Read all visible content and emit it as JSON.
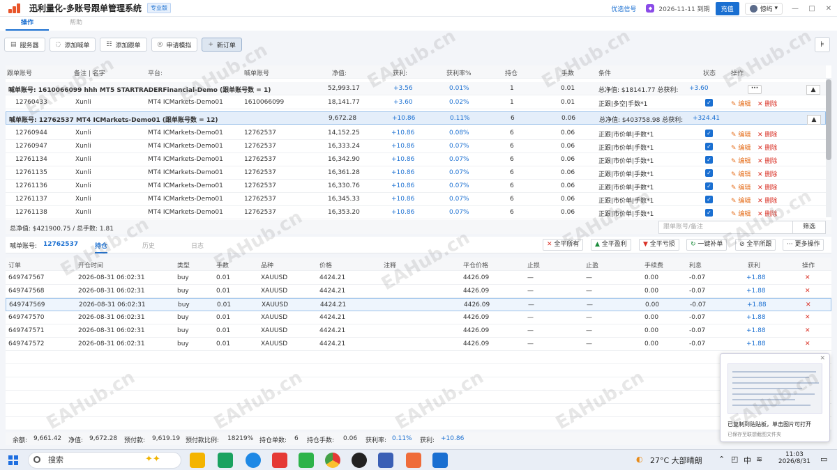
{
  "header": {
    "app_title": "迅利量化-多账号跟单管理系统",
    "edition_badge": "专业版",
    "signal_link": "优选信号",
    "expiry": "2026-11-11 到期",
    "recharge": "充值",
    "username": "惊屿",
    "user_caret": "▾"
  },
  "tabs": [
    "操作",
    "帮助"
  ],
  "toolbar": [
    "服务器",
    "添加喊单",
    "添加跟单",
    "申请模拟",
    "新订单"
  ],
  "follow_table": {
    "headers": [
      "跟单账号",
      "备注 | 名字",
      "平台:",
      "喊单账号",
      "净值:",
      "获利:",
      "获利率%",
      "持仓",
      "手数",
      "条件",
      "状态",
      "操作"
    ],
    "group1": {
      "label": "喊单账号: 1610066099  hhh  MT5 STARTRADERFinancial-Demo (跟单账号数 = 1)",
      "equity": "52,993.17",
      "profit": "+3.56",
      "rate": "0.01%",
      "pos": "1",
      "lots": "0.01",
      "cond": "总净值: $18141.77   总获利: ",
      "cond_profit": "+3.60"
    },
    "child1": {
      "acct": "12760433",
      "note": "Xunli",
      "platform": "MT4 ICMarkets-Demo01",
      "master": "1610066099",
      "equity": "18,141.77",
      "profit": "+3.60",
      "rate": "0.02%",
      "pos": "1",
      "lots": "0.01",
      "cond": "正跟|多空|手数*1"
    },
    "group2": {
      "label": "喊单账号: 12762537  MT4 ICMarkets-Demo01 (跟单账号数 = 12)",
      "equity": "9,672.28",
      "profit": "+10.86",
      "rate": "0.11%",
      "pos": "6",
      "lots": "0.06",
      "cond": "总净值: $403758.98   总获利: ",
      "cond_profit": "+324.41"
    },
    "rows": [
      {
        "acct": "12760944",
        "equity": "14,152.25"
      },
      {
        "acct": "12760947",
        "equity": "16,333.24"
      },
      {
        "acct": "12761134",
        "equity": "16,342.90"
      },
      {
        "acct": "12761135",
        "equity": "16,361.28"
      },
      {
        "acct": "12761136",
        "equity": "16,330.76"
      },
      {
        "acct": "12761137",
        "equity": "16,345.33"
      },
      {
        "acct": "12761138",
        "equity": "16,353.20"
      }
    ],
    "row_common": {
      "note": "Xunli",
      "platform": "MT4 ICMarkets-Demo01",
      "master": "12762537",
      "profit": "+10.86",
      "rate": "0.07%",
      "pos": "6",
      "lots": "0.06",
      "cond": "正跟|市价单|手数*1"
    },
    "first_row_rate": "0.08%",
    "edit": "✎ 编辑",
    "delete": "✕ 删除",
    "more": "···",
    "up": "▲"
  },
  "summary": {
    "text": "总净值: $421900.75 / 总手数:  1.81",
    "filter_placeholder": "跟单账号/备注",
    "filter_btn": "筛选"
  },
  "positions": {
    "master_label": "喊单账号:",
    "master_value": "12762537",
    "tabs": [
      "持仓",
      "历史",
      "日志"
    ],
    "actions": [
      "全平所有",
      "全平盈利",
      "全平亏损",
      "一键补单",
      "全平所跟",
      "更多操作"
    ],
    "headers": [
      "订单",
      "开仓时间",
      "类型",
      "手数",
      "品种",
      "价格",
      "注释",
      "平仓价格",
      "止损",
      "止盈",
      "手续费",
      "利息",
      "获利",
      "操作"
    ],
    "rows": [
      {
        "order": "649747567"
      },
      {
        "order": "649747568"
      },
      {
        "order": "649747569"
      },
      {
        "order": "649747570"
      },
      {
        "order": "649747571"
      },
      {
        "order": "649747572"
      }
    ],
    "common": {
      "time": "2026-08-31 06:02:31",
      "type": "buy",
      "lots": "0.01",
      "symbol": "XAUUSD",
      "price": "4424.21",
      "comment": "",
      "close": "4426.09",
      "sl": "—",
      "tp": "—",
      "fee": "0.00",
      "swap": "-0.07",
      "profit": "+1.88",
      "del": "✕"
    }
  },
  "footer": {
    "balance_l": "余额:",
    "balance": "9,661.42",
    "equity_l": "净值:",
    "equity": "9,672.28",
    "margin_l": "预付款:",
    "margin": "9,619.19",
    "ratio_l": "预付款比例:",
    "ratio": "18219%",
    "orders_l": "持仓单数:",
    "orders": "6",
    "lots_l": "持仓手数:",
    "lots": "0.06",
    "rate_l": "获利率:",
    "rate": "0.11%",
    "profit_l": "获利:",
    "profit": "+10.86"
  },
  "toast": {
    "t1": "已复制到贴贴板，单击图片可打开",
    "t2": "已保存至联想截图文件夹",
    "close": "✕"
  },
  "taskbar": {
    "search": "搜索",
    "weather": "27°C  大部晴朗",
    "lang": "中",
    "time": "11:03",
    "date": "2026/8/31"
  },
  "watermark": "EAHub.cn",
  "colors": {
    "accent": "#1a6fd1",
    "delete": "#d93025",
    "edit": "#e56e1c"
  }
}
